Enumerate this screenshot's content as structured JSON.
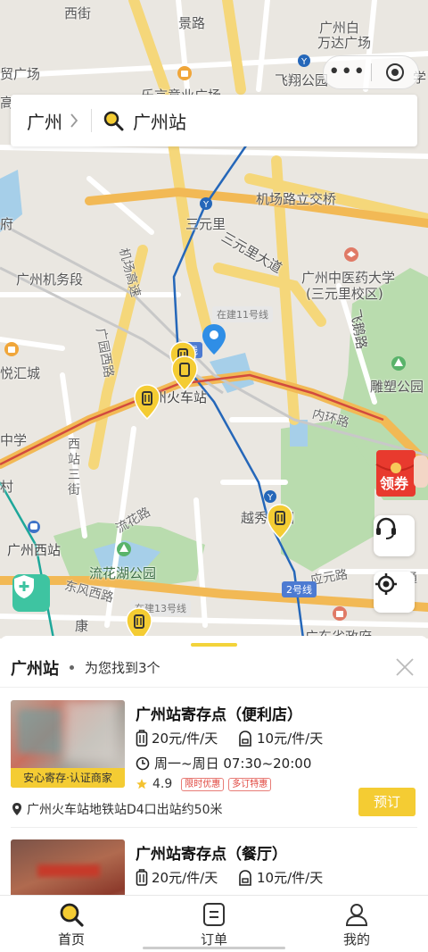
{
  "search": {
    "city": "广州",
    "query": "广州站"
  },
  "map": {
    "labels": {
      "xijie": "西街",
      "jingroad": "景路",
      "guangzhou_bai": "广州白",
      "wanda": "万达广场",
      "feixiang_park": "飞翔公园",
      "lechang": "乐言意业广场",
      "airport_bridge": "机场路立交桥",
      "sanyuanli": "三元里",
      "sanyuanli_ave": "三元里大道",
      "guangzhou_jiwu": "广州机务段",
      "tcm_univ": "广州中医药大学",
      "tcm_campus": "(三元里校区)",
      "line11": "在建11号线",
      "airport_hwy": "机场高速",
      "guangyuan_west": "广园西路",
      "huicheng": "悦汇城",
      "gz_station": "州火车站",
      "diaosu_park": "雕塑公园",
      "inner_ring": "内环路",
      "xizhan_street": "西站三街",
      "yuexiu_park": "越秀公园",
      "liuhua_road": "流花路",
      "gz_west": "广州西站",
      "liuhua_lake": "流花湖公园",
      "dongfeng_west": "东风西路",
      "yingyuan": "应元路",
      "line2": "2号线",
      "line13": "在建13号线",
      "feie": "飞鹅路",
      "xue": "学",
      "fu": "府",
      "cun": "村",
      "zhongxue": "中学",
      "kang": "康",
      "xian": "线",
      "shengzheng": "广东省政府",
      "maoguang": "贸广场",
      "gao": "高",
      "dong": "东",
      "tong": "通"
    }
  },
  "floating": {
    "coupon_label": "领券"
  },
  "sheet": {
    "station": "广州站",
    "found_text": "为您找到3个",
    "items": [
      {
        "name": "广州站寄存点（便利店）",
        "large_price": "20元/件/天",
        "small_price": "10元/件/天",
        "hours": "周一~周日 07:30~20:00",
        "rating": "4.9",
        "tags": [
          "限时优惠",
          "多订特惠"
        ],
        "badge": "安心寄存·认证商家",
        "address": "广州火车站地铁站D4口出站约50米",
        "book_label": "预订"
      },
      {
        "name": "广州站寄存点（餐厅）",
        "large_price": "20元/件/天",
        "small_price": "10元/件/天"
      }
    ]
  },
  "tabs": [
    {
      "label": "首页",
      "icon": "search-icon"
    },
    {
      "label": "订单",
      "icon": "order-icon"
    },
    {
      "label": "我的",
      "icon": "user-icon"
    }
  ],
  "colors": {
    "accent": "#f4cc33",
    "metro_blue": "#4d7bd2",
    "park_green": "#b9dcae",
    "highway_orange": "#f2b955"
  }
}
